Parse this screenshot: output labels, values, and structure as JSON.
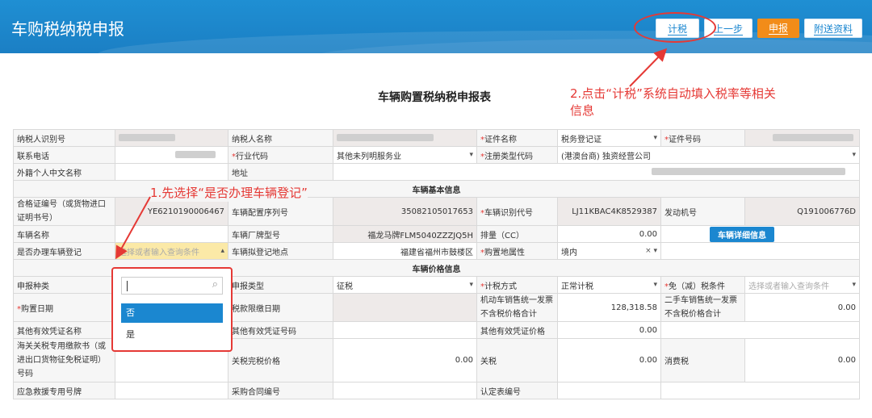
{
  "header": {
    "title": "车购税纳税申报",
    "buttons": {
      "calc": "计税",
      "prev": "上一步",
      "declare": "申报",
      "attach": "附送资料"
    }
  },
  "form_title": "车辆购置税纳税申报表",
  "annotations": {
    "step2_line1": "2.点击“计税”系统自动填入税率等相关",
    "step2_line2": "信息",
    "step1": "1.先选择“是否办理车辆登记”"
  },
  "labels": {
    "taxpayer_id": "纳税人识别号",
    "taxpayer_name": "纳税人名称",
    "cert_name": "证件名称",
    "cert_no": "证件号码",
    "phone": "联系电话",
    "industry": "行业代码",
    "reg_type": "注册类型代码",
    "foreign_name": "外籍个人中文名称",
    "address": "地址",
    "vehicle_basic": "车辆基本信息",
    "cert_code": "合格证编号（或货物进口证明书号）",
    "config_no": "车辆配置序列号",
    "vin": "车辆识别代号",
    "engine_no": "发动机号",
    "vehicle_name": "车辆名称",
    "model": "车辆厂牌型号",
    "displacement": "排量（CC）",
    "register": "是否办理车辆登记",
    "reg_place": "车辆拟登记地点",
    "purchase_attr": "购置地属性",
    "vehicle_price": "车辆价格信息",
    "declare_type": "申报种类",
    "report_type": "申报类型",
    "calc_method": "计税方式",
    "exempt": "免（减）税条件",
    "purchase_date": "购置日期",
    "deadline": "税款限缴日期",
    "invoice_price": "机动车销售统一发票不含税价格合计",
    "used_invoice_price": "二手车销售统一发票不含税价格合计",
    "other_voucher_name": "其他有效凭证名称",
    "other_voucher_no": "其他有效凭证号码",
    "other_voucher_price": "其他有效凭证价格",
    "customs_doc": "海关关税专用缴款书（或进出口货物征免税证明）号码",
    "customs_price": "关税完税价格",
    "tariff": "关税",
    "consumption_tax": "消费税",
    "rescue_plate": "应急救援专用号牌",
    "contract_no": "采购合同编号",
    "cert_table_no": "认定表编号"
  },
  "values": {
    "cert_name": "税务登记证",
    "industry": "其他未列明服务业",
    "reg_type": "(港澳台商) 独资经营公司",
    "cert_code": "YE6210190006467",
    "config_no": "35082105017653",
    "vin": "LJ11KBAC4K8529387",
    "engine_no": "Q191006776D",
    "model": "福龙马牌FLM5040ZZZJQ5H",
    "displacement": "0.00",
    "detail_btn": "车辆详细信息",
    "register_placeholder": "选择或者输入查询条件",
    "reg_place": "福建省福州市鼓楼区",
    "purchase_attr": "境内",
    "report_type": "征税",
    "calc_method": "正常计税",
    "exempt_placeholder": "选择或者输入查询条件",
    "invoice_price": "128,318.58",
    "used_invoice_price": "0.00",
    "other_voucher_price": "0.00",
    "customs_price": "0.00",
    "tariff": "0.00",
    "consumption_tax": "0.00"
  },
  "dropdown": {
    "options": [
      "否",
      "是"
    ],
    "selected": "否"
  },
  "colors": {
    "header_blue": "#1b87d0",
    "orange": "#f28c19",
    "annotation_red": "#e53935"
  }
}
